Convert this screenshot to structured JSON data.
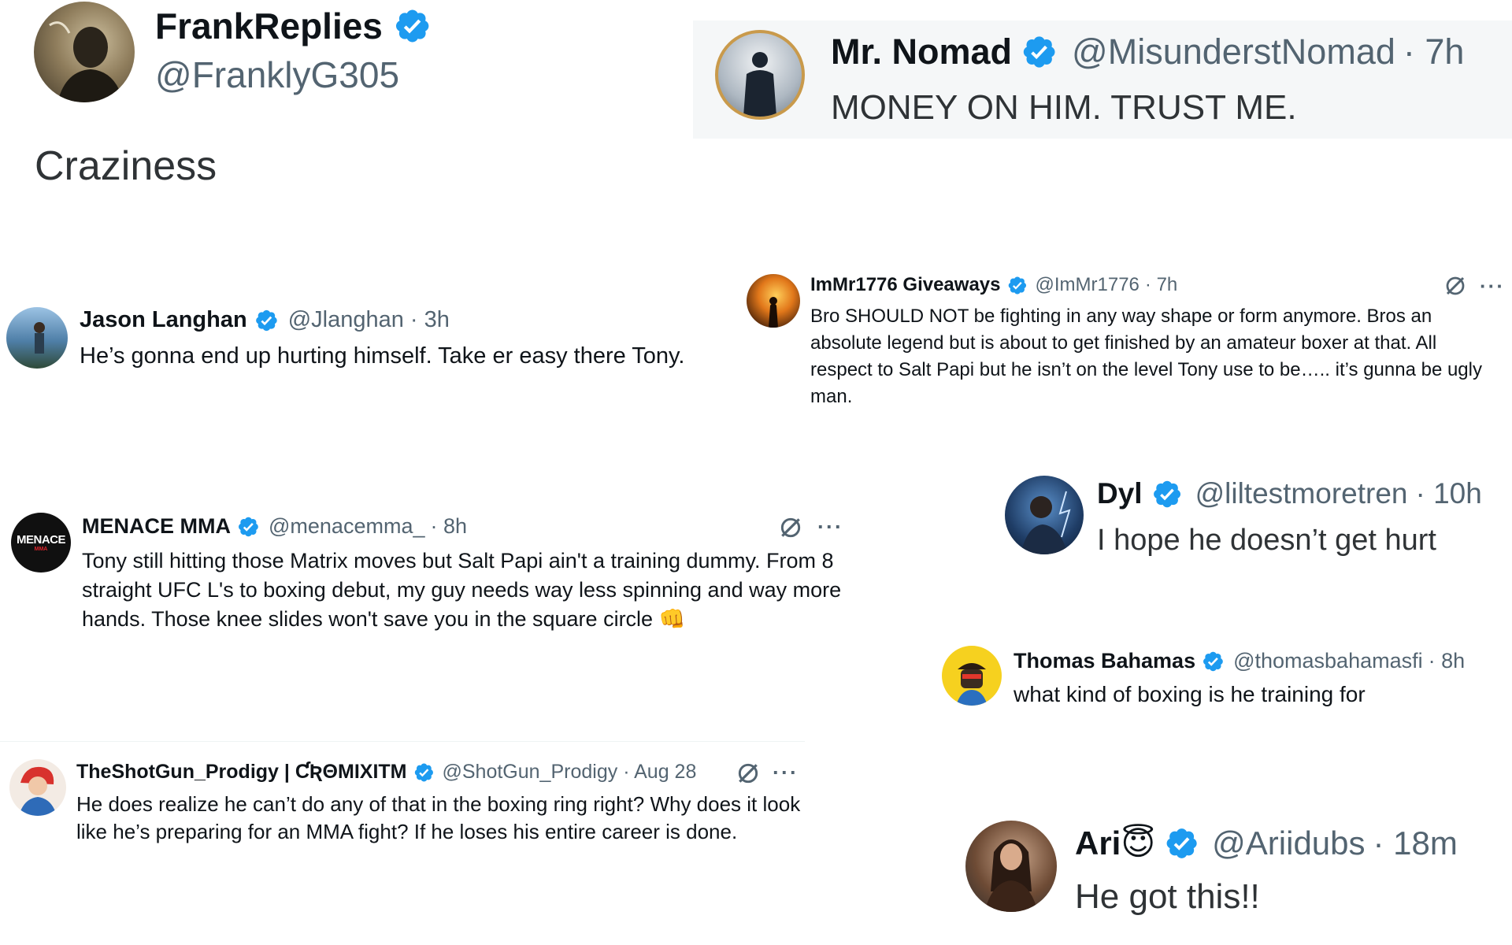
{
  "colors": {
    "verified": "#1d9bf0",
    "handle": "#536471",
    "text": "#0f1419"
  },
  "main_post": {
    "name": "FrankReplies",
    "handle": "@FranklyG305",
    "text": "Craziness",
    "avatar_icon": "man-portrait-avatar"
  },
  "replies": [
    {
      "id": "nomad",
      "name": "Mr. Nomad",
      "handle": "@MisunderstNomad",
      "time": "· 7h",
      "text": "MONEY ON HIM. TRUST ME."
    },
    {
      "id": "jason",
      "name": "Jason Langhan",
      "handle": "@Jlanghan",
      "time": "· 3h",
      "text": "He’s gonna end up hurting himself. Take er easy there Tony."
    },
    {
      "id": "immr",
      "name": "ImMr1776 Giveaways",
      "handle": "@ImMr1776",
      "time": "· 7h",
      "text": "Bro SHOULD NOT be fighting in any way shape or form anymore. Bros an absolute legend but is about to get finished by an amateur boxer at that. All respect to Salt Papi but he isn’t on the level Tony use to be….. it’s gunna be ugly man."
    },
    {
      "id": "menace",
      "name": "MENACE MMA",
      "handle": "@menacemma_",
      "time": "· 8h",
      "text": "Tony still hitting those Matrix moves but Salt Papi ain't a training dummy. From 8 straight UFC L's to boxing debut, my guy needs way less spinning and way more hands. Those knee slides won't save you in the square circle 👊",
      "avatar_text": "MENACE",
      "avatar_subtext": "MMA"
    },
    {
      "id": "dyl",
      "name": "Dyl",
      "handle": "@liltestmoretren",
      "time": "· 10h",
      "text": "I hope he doesn’t get hurt"
    },
    {
      "id": "thomas",
      "name": "Thomas Bahamas",
      "handle": "@thomasbahamasfi",
      "time": "· 8h",
      "text": "what kind of boxing is he training for"
    },
    {
      "id": "shotgun",
      "name": "TheShotGun_Prodigy | ƇƦΘΜΙΧΙTM",
      "handle": "@ShotGun_Prodigy",
      "time": "· Aug 28",
      "text": "He does realize he can’t do any of that in the boxing ring right? Why does it look like he’s preparing for an MMA fight? If he loses his entire career is done."
    },
    {
      "id": "ari",
      "name": "Ari😇",
      "handle": "@Ariidubs",
      "time": "· 18m",
      "text": "He got this!!"
    }
  ],
  "icons": {
    "verified": "verified-badge-icon",
    "grok": "grok-icon",
    "more": "more-options-icon"
  },
  "more_label": "···"
}
